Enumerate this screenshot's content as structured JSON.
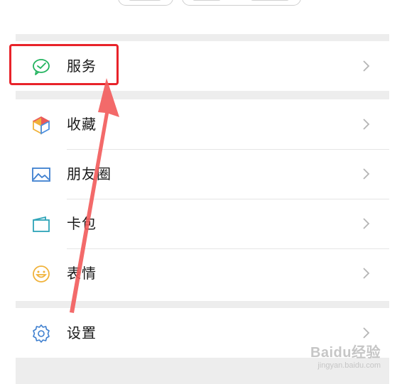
{
  "menu": {
    "items": [
      {
        "label": "服务",
        "icon": "wechat-pay-icon"
      },
      {
        "label": "收藏",
        "icon": "favorites-cube-icon"
      },
      {
        "label": "朋友圈",
        "icon": "moments-picture-icon"
      },
      {
        "label": "卡包",
        "icon": "card-wallet-icon"
      },
      {
        "label": "表情",
        "icon": "sticker-smile-icon"
      },
      {
        "label": "设置",
        "icon": "settings-gear-icon"
      }
    ]
  },
  "colors": {
    "highlight": "#e8232a",
    "arrow": "#f25a5a",
    "service_icon": "#22b35e",
    "settings_icon": "#3e7fcf"
  },
  "watermark": {
    "brand": "Baidu经验",
    "url": "jingyan.baidu.com"
  }
}
